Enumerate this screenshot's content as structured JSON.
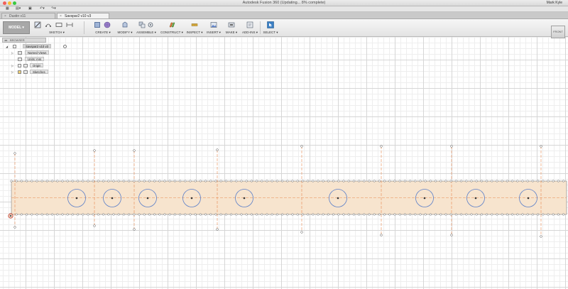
{
  "window": {
    "title": "Autodesk Fusion 360  (Updating... 8% complete)",
    "user": "Mark Kyle",
    "traffic_light_colors": [
      "#f25f58",
      "#fbbe2e",
      "#39c840"
    ]
  },
  "tabs": [
    {
      "label": "Dustin v11",
      "active": false
    },
    {
      "label": "Savspar2 v10 v3",
      "active": true
    }
  ],
  "workspace": {
    "label": "MODEL"
  },
  "toolbar": {
    "groups": [
      {
        "label": "SKETCH"
      },
      {
        "label": "CREATE"
      },
      {
        "label": "MODIFY"
      },
      {
        "label": "ASSEMBLE"
      },
      {
        "label": "CONSTRUCT"
      },
      {
        "label": "INSPECT"
      },
      {
        "label": "INSERT"
      },
      {
        "label": "MAKE"
      },
      {
        "label": "ADD-INS"
      },
      {
        "label": "SELECT"
      }
    ]
  },
  "viewcube": {
    "label": "FRONT"
  },
  "browser": {
    "title": "BROWSER",
    "root": "Savspar2 v10 v3",
    "nodes": [
      {
        "label": "Named Views"
      },
      {
        "label": "Units: mm"
      },
      {
        "label": "Origin"
      },
      {
        "label": "Sketches"
      }
    ]
  },
  "sketch_colors": {
    "body_fill": "#f7e4ce",
    "outline": "#7d7d7d",
    "circle": "#5b7fc9",
    "centerline": "#e8894f",
    "point": "#5a5a5a",
    "origin": "#c0392b"
  }
}
